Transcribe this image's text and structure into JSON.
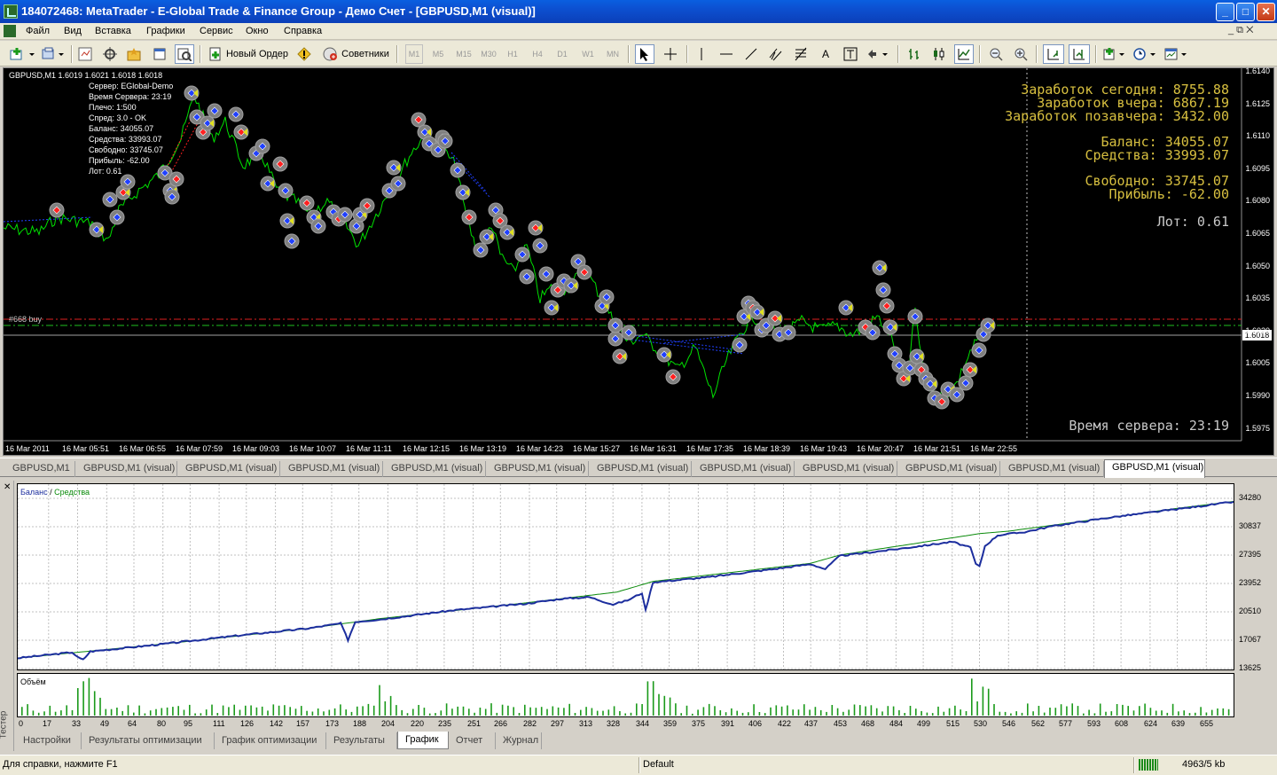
{
  "window": {
    "title": "184072468: MetaTrader - E-Global Trade & Finance Group - Демо Счет - [GBPUSD,M1 (visual)]",
    "btn_min": "_",
    "btn_max": "□",
    "btn_close": "✕"
  },
  "menu": {
    "items": [
      "Файл",
      "Вид",
      "Вставка",
      "Графики",
      "Сервис",
      "Окно",
      "Справка"
    ],
    "mdi_controls": "_  ⧉  ✕"
  },
  "toolbar": {
    "new_order": "Новый Ордер",
    "experts": "Советники",
    "timeframes": [
      "M1",
      "M5",
      "M15",
      "M30",
      "H1",
      "H4",
      "D1",
      "W1",
      "MN"
    ]
  },
  "chart": {
    "header": "GBPUSD,M1  1.6019 1.6021 1.6018 1.6018",
    "info_lines": [
      "Сервер:  EGlobal-Demo",
      "Время Сервера:  23:19",
      "Плечо:  1:500",
      "Спред:  3.0 - OK",
      "Баланс:  34055.07",
      "Средства:  33993.07",
      "Свободно:  33745.07",
      "Прибыль:  -62.00",
      "Лот:  0.61"
    ],
    "earn_today": "Заработок сегодня: 8755.88",
    "earn_yesterday": "Заработок вчера: 6867.19",
    "earn_daybefore": "Заработок позавчера: 3432.00",
    "balance": "Баланс: 34055.07",
    "equity": "Средства: 33993.07",
    "free": "Свободно: 33745.07",
    "profit": "Прибыль:    -62.00",
    "lot": "Лот: 0.61",
    "server_time": "Время сервера: 23:19",
    "buy_label": "#668 buy",
    "current_price": "1.6018",
    "price_ticks": [
      "1.6140",
      "1.6125",
      "1.6110",
      "1.6095",
      "1.6080",
      "1.6065",
      "1.6050",
      "1.6035",
      "1.6020",
      "1.6005",
      "1.5990",
      "1.5975"
    ],
    "time_ticks": [
      "16 Mar 2011",
      "16 Mar 05:51",
      "16 Mar 06:55",
      "16 Mar 07:59",
      "16 Mar 09:03",
      "16 Mar 10:07",
      "16 Mar 11:11",
      "16 Mar 12:15",
      "16 Mar 13:19",
      "16 Mar 14:23",
      "16 Mar 15:27",
      "16 Mar 16:31",
      "16 Mar 17:35",
      "16 Mar 18:39",
      "16 Mar 19:43",
      "16 Mar 20:47",
      "16 Mar 21:51",
      "16 Mar 22:55"
    ],
    "colors": {
      "bg": "#000000",
      "line": "#00e000",
      "equity_text": "#d8c040"
    }
  },
  "chart_tabs": [
    "GBPUSD,M1",
    "GBPUSD,M1 (visual)",
    "GBPUSD,M1 (visual)",
    "GBPUSD,M1 (visual)",
    "GBPUSD,M1 (visual)",
    "GBPUSD,M1 (visual)",
    "GBPUSD,M1 (visual)",
    "GBPUSD,M1 (visual)",
    "GBPUSD,M1 (visual)",
    "GBPUSD,M1 (visual)",
    "GBPUSD,M1 (visual)",
    "GBPUSD,M1 (visual)"
  ],
  "tester": {
    "side_label": "Тестер",
    "close": "✕",
    "legend_balance": "Баланс",
    "legend_sep": " / ",
    "legend_equity": "Средства",
    "volume_label": "Объём",
    "tabs": [
      "Настройки",
      "Результаты оптимизации",
      "График оптимизации",
      "Результаты",
      "График",
      "Отчет",
      "Журнал"
    ],
    "active_tab": "График"
  },
  "chart_data": {
    "type": "line",
    "xlabel": "",
    "ylabel": "",
    "y_ticks": [
      34280,
      30837,
      27395,
      23952,
      20510,
      17067,
      13625
    ],
    "x_ticks": [
      0,
      17,
      33,
      49,
      64,
      80,
      95,
      111,
      126,
      142,
      157,
      173,
      188,
      204,
      220,
      235,
      251,
      266,
      282,
      297,
      313,
      328,
      344,
      359,
      375,
      391,
      406,
      422,
      437,
      453,
      468,
      484,
      499,
      515,
      530,
      546,
      562,
      577,
      593,
      608,
      624,
      639,
      655
    ],
    "xlim": [
      0,
      670
    ],
    "ylim": [
      12000,
      35500
    ],
    "series": [
      {
        "name": "Баланс",
        "color": "#1c2e9e",
        "x": [
          0,
          30,
          33,
          36,
          40,
          80,
          120,
          160,
          178,
          182,
          186,
          200,
          240,
          280,
          300,
          315,
          328,
          336,
          344,
          346,
          350,
          380,
          420,
          437,
          445,
          453,
          480,
          515,
          525,
          528,
          530,
          533,
          540,
          555,
          570,
          600,
          640,
          670
        ],
        "y": [
          14900,
          15600,
          15000,
          14700,
          15700,
          16600,
          17600,
          18500,
          19100,
          17100,
          19300,
          19600,
          20700,
          21500,
          22100,
          22300,
          21400,
          21900,
          22800,
          20700,
          24100,
          24700,
          25800,
          26300,
          25700,
          27300,
          28000,
          29000,
          28300,
          26300,
          26000,
          28500,
          29800,
          30200,
          30900,
          31900,
          33000,
          33850
        ]
      },
      {
        "name": "Средства",
        "color": "#0a8a0a",
        "x": [
          0,
          80,
          160,
          200,
          280,
          330,
          344,
          350,
          437,
          453,
          530,
          546,
          600,
          640,
          670
        ],
        "y": [
          14900,
          16600,
          18500,
          19700,
          21600,
          22900,
          23800,
          24200,
          26400,
          27400,
          30000,
          30300,
          31900,
          33100,
          33900
        ]
      }
    ]
  },
  "status": {
    "help": "Для справки, нажмите F1",
    "profile": "Default",
    "traffic": "4963/5 kb"
  }
}
